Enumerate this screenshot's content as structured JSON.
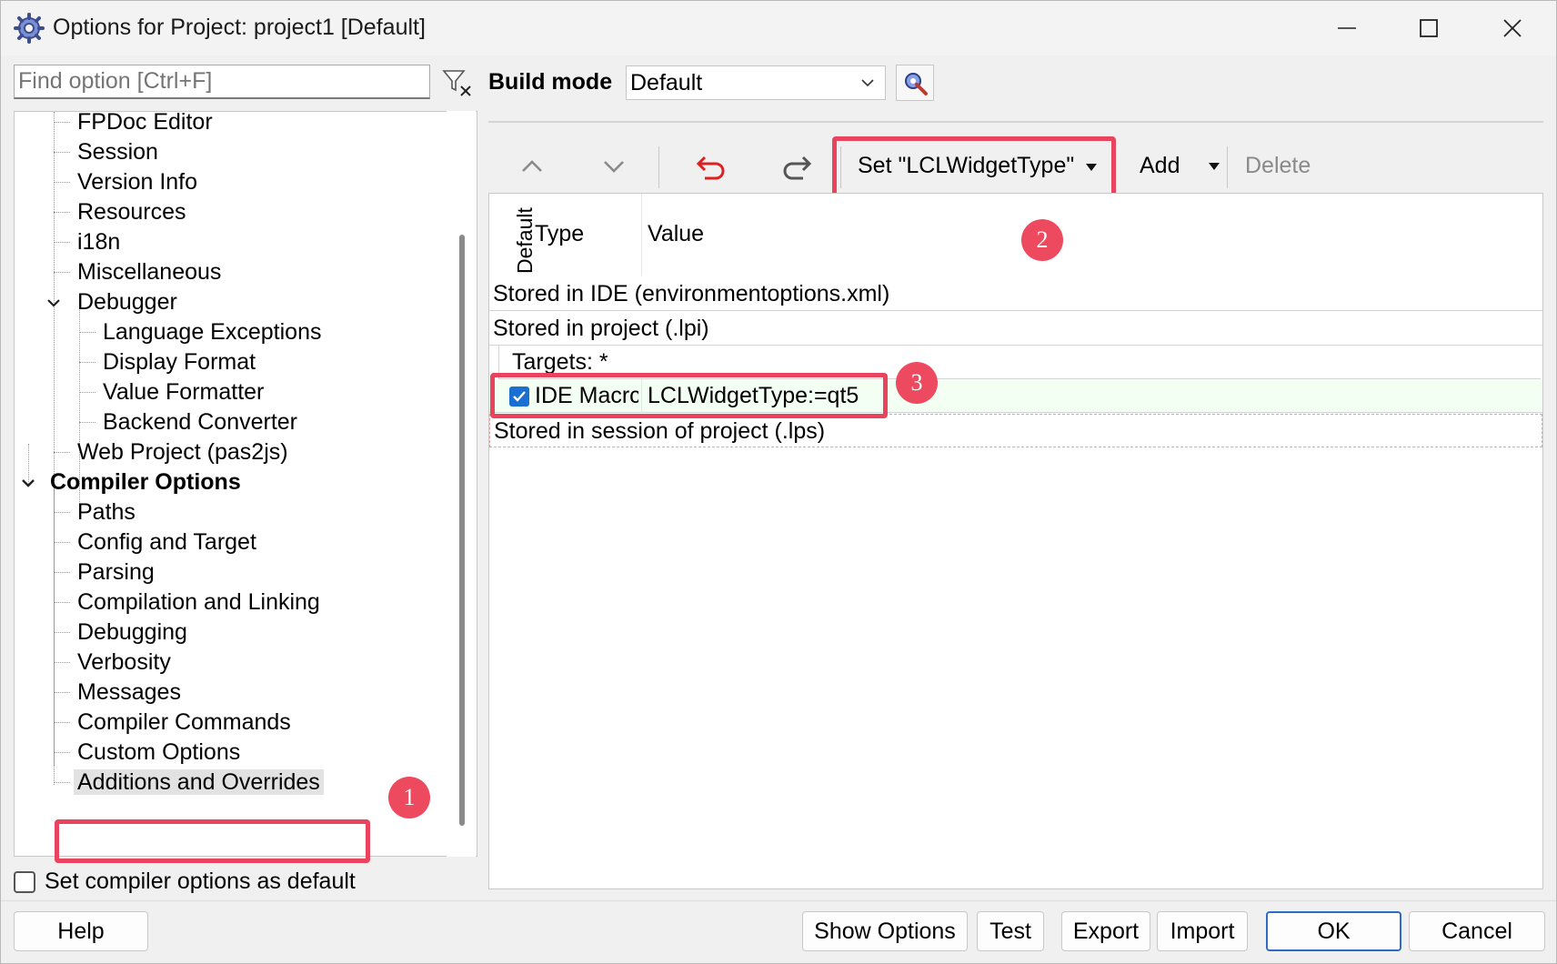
{
  "window": {
    "title": "Options for Project: project1 [Default]"
  },
  "search": {
    "placeholder": "Find option [Ctrl+F]"
  },
  "tree": {
    "items": [
      {
        "label": "FPDoc Editor"
      },
      {
        "label": "Session"
      },
      {
        "label": "Version Info"
      },
      {
        "label": "Resources"
      },
      {
        "label": "i18n"
      },
      {
        "label": "Miscellaneous"
      },
      {
        "label": "Debugger"
      },
      {
        "label": "Language Exceptions"
      },
      {
        "label": "Display Format"
      },
      {
        "label": "Value Formatter"
      },
      {
        "label": "Backend Converter"
      },
      {
        "label": "Web Project (pas2js)"
      },
      {
        "label": "Compiler Options"
      },
      {
        "label": "Paths"
      },
      {
        "label": "Config and Target"
      },
      {
        "label": "Parsing"
      },
      {
        "label": "Compilation and Linking"
      },
      {
        "label": "Debugging"
      },
      {
        "label": "Verbosity"
      },
      {
        "label": "Messages"
      },
      {
        "label": "Compiler Commands"
      },
      {
        "label": "Custom Options"
      },
      {
        "label": "Additions and Overrides"
      }
    ],
    "selected": "Additions and Overrides"
  },
  "default_checkbox": {
    "label": "Set compiler options as default",
    "checked": false
  },
  "build_mode": {
    "label": "Build mode",
    "value": "Default"
  },
  "toolbar": {
    "set_label": "Set \"LCLWidgetType\"",
    "add_label": "Add",
    "delete_label": "Delete"
  },
  "grid": {
    "header_default": "Default",
    "header_type": "Type",
    "header_value": "Value",
    "rows": [
      {
        "text": "Stored in IDE (environmentoptions.xml)"
      },
      {
        "text": "Stored in project (.lpi)"
      },
      {
        "text": "Targets: *"
      },
      {
        "type": "IDE Macro",
        "type_display": "IDE Macrc",
        "value": "LCLWidgetType:=qt5",
        "checked": true
      },
      {
        "text": "Stored in session of project (.lps)"
      }
    ]
  },
  "annotations": {
    "badge1": "1",
    "badge2": "2",
    "badge3": "3",
    "accent_color": "#e8445e"
  },
  "buttons": {
    "help": "Help",
    "show_options": "Show Options",
    "test": "Test",
    "export": "Export",
    "import": "Import",
    "ok": "OK",
    "cancel": "Cancel"
  }
}
